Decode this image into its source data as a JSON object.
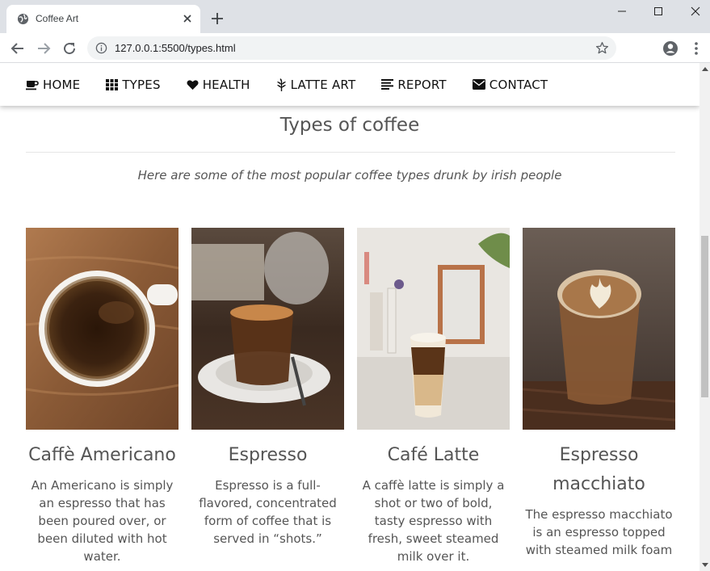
{
  "browser": {
    "tab_title": "Coffee Art",
    "url": "127.0.0.1:5500/types.html"
  },
  "nav": {
    "items": [
      {
        "label": "HOME",
        "icon": "coffee-cup-icon"
      },
      {
        "label": "TYPES",
        "icon": "grid-icon"
      },
      {
        "label": "HEALTH",
        "icon": "heart-icon"
      },
      {
        "label": "LATTE ART",
        "icon": "leaf-icon"
      },
      {
        "label": "REPORT",
        "icon": "text-lines-icon"
      },
      {
        "label": "CONTACT",
        "icon": "envelope-icon"
      }
    ]
  },
  "main": {
    "title": "Types of coffee",
    "subtitle": "Here are some of the most popular coffee types drunk by irish people",
    "cards": [
      {
        "title": "Caffè Americano",
        "text": "An Americano is simply an espresso that has been poured over, or been diluted with hot water."
      },
      {
        "title": "Espresso",
        "text": "Espresso is a full-flavored, concentrated form of coffee that is served in “shots.”"
      },
      {
        "title": "Café Latte",
        "text": "A caffè latte is simply a shot or two of bold, tasty espresso with fresh, sweet steamed milk over it."
      },
      {
        "title": "Espresso macchiato",
        "text": "The espresso macchiato is an espresso topped with steamed milk foam"
      }
    ]
  },
  "colors": {
    "tabstrip": "#dee1e6",
    "text_grey": "#555555",
    "nav_text": "#111111"
  }
}
